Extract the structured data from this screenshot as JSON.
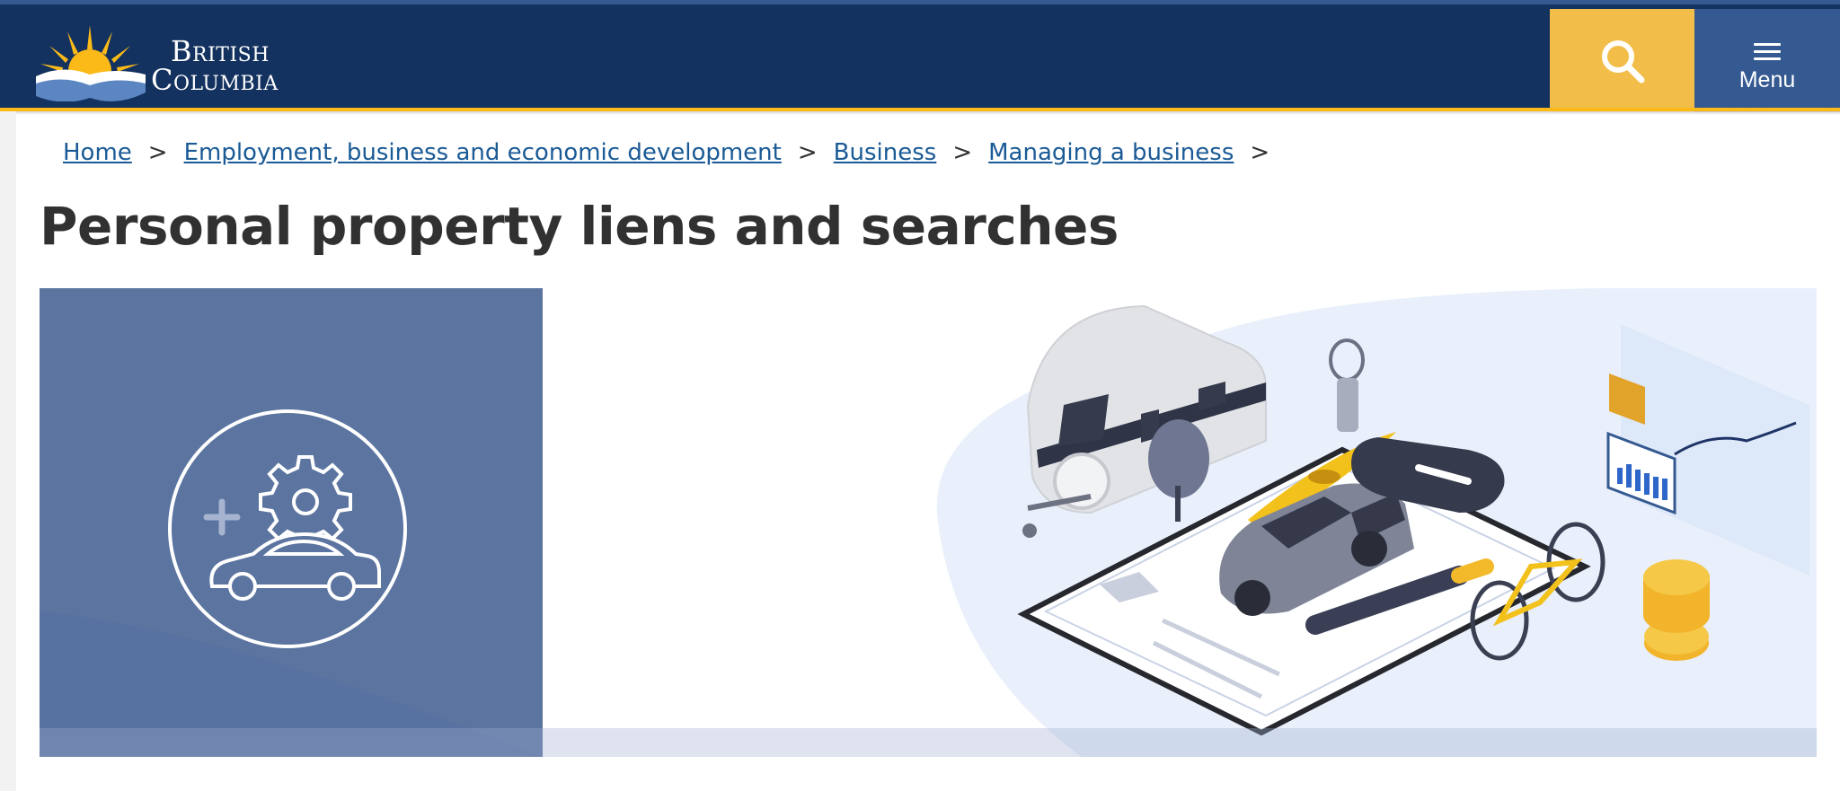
{
  "header": {
    "logo": {
      "line1": "British",
      "line2": "Columbia"
    },
    "search_icon": "search-icon",
    "menu_icon": "hamburger-icon",
    "menu_label": "Menu",
    "colors": {
      "header_bg": "#13325f",
      "accent": "#fcba19",
      "menu_bg": "#355991",
      "search_bg": "#f2bd48"
    }
  },
  "breadcrumb": {
    "items": [
      {
        "label": "Home"
      },
      {
        "label": "Employment, business and economic development"
      },
      {
        "label": "Business"
      },
      {
        "label": "Managing a business"
      }
    ],
    "separator": ">"
  },
  "page": {
    "title": "Personal property liens and searches"
  },
  "banner": {
    "left_icon": "car-gear-icon",
    "illustration": "vehicles-and-property-illustration",
    "colors": {
      "left_panel": "#5b74a0",
      "illustration_bg": "#e9f0fb"
    }
  }
}
